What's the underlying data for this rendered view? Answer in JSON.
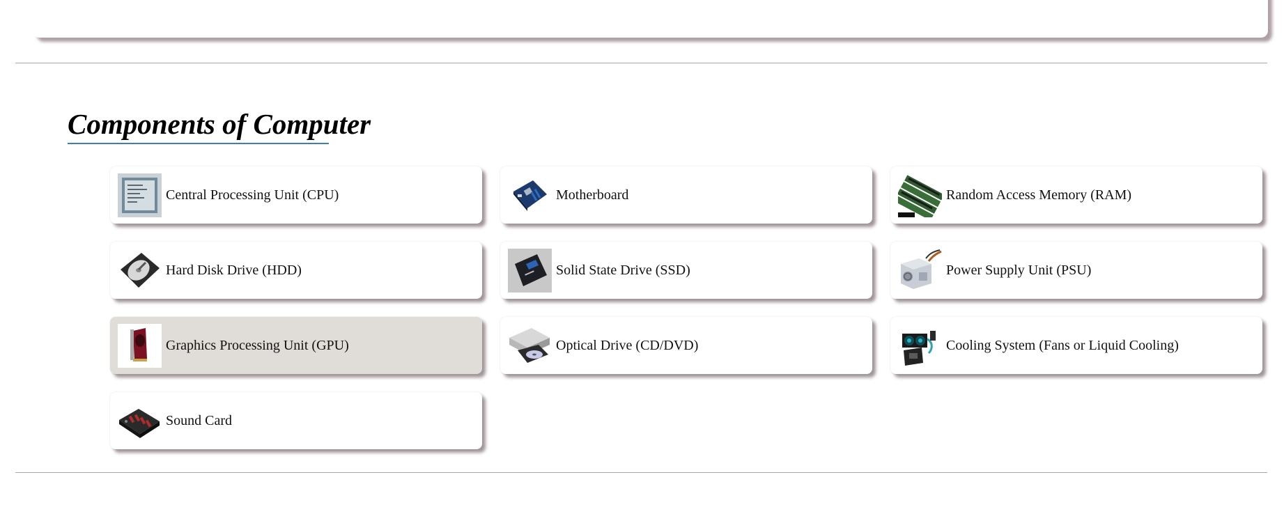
{
  "section": {
    "title": "Components of Computer"
  },
  "components": [
    {
      "label": "Central Processing Unit (CPU)",
      "icon": "cpu-chip-icon"
    },
    {
      "label": "Motherboard",
      "icon": "motherboard-icon"
    },
    {
      "label": "Random Access Memory (RAM)",
      "icon": "ram-sticks-icon"
    },
    {
      "label": "Hard Disk Drive (HDD)",
      "icon": "hard-disk-icon"
    },
    {
      "label": "Solid State Drive (SSD)",
      "icon": "ssd-icon"
    },
    {
      "label": "Power Supply Unit (PSU)",
      "icon": "power-supply-icon"
    },
    {
      "label": "Graphics Processing Unit (GPU)",
      "icon": "graphics-card-icon",
      "highlighted": true
    },
    {
      "label": "Optical Drive (CD/DVD)",
      "icon": "optical-drive-icon"
    },
    {
      "label": "Cooling System (Fans or Liquid Cooling)",
      "icon": "cooling-system-icon"
    },
    {
      "label": "Sound Card",
      "icon": "sound-card-icon"
    }
  ],
  "colors": {
    "accent_underline": "#3b7bbf",
    "card_highlight": "#e0ddd9",
    "rule": "#a9a9a9"
  }
}
